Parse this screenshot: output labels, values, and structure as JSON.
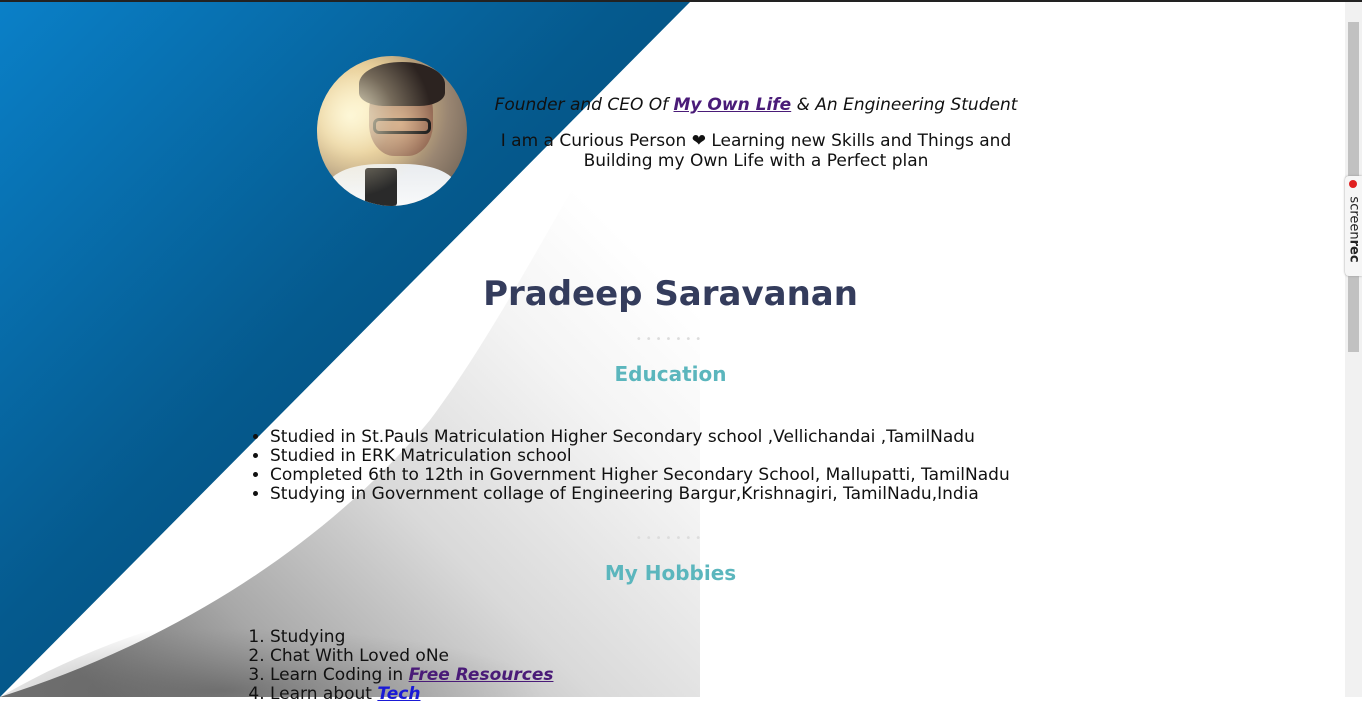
{
  "profile": {
    "tagline_prefix": "Founder and CEO Of ",
    "tagline_link": "My Own Life",
    "tagline_suffix": " & An Engineering Student",
    "about_prefix": "I am a Curious Person ",
    "about_heart": "❤",
    "about_suffix": " Learning new Skills and Things and Building my Own Life with a Perfect plan",
    "name": "Pradeep Saravanan"
  },
  "education": {
    "title": "Education",
    "items": [
      "Studied in St.Pauls Matriculation Higher Secondary school ,Vellichandai ,TamilNadu",
      "Studied in ERK Matriculation school",
      "Completed 6th to 12th in Government Higher Secondary School, Mallupatti, TamilNadu",
      "Studying in Government collage of Engineering Bargur,Krishnagiri, TamilNadu,India"
    ]
  },
  "hobbies": {
    "title": "My Hobbies",
    "item1": "Studying",
    "item2": "Chat With Loved oNe",
    "item3_prefix": "Learn Coding in ",
    "item3_link": "Free Resources",
    "item4_prefix": "Learn about ",
    "item4_link": "Tech"
  },
  "dividers": {
    "text": "•••••••"
  },
  "screenrec": {
    "brand_light": "screen",
    "brand_bold": "rec"
  },
  "colors": {
    "accent_teal": "#5bb6bd",
    "name_navy": "#343c5c",
    "link_purple": "#4a1b78",
    "link_blue": "#1a1ad6",
    "bg_blue": "#0a7fc6"
  }
}
